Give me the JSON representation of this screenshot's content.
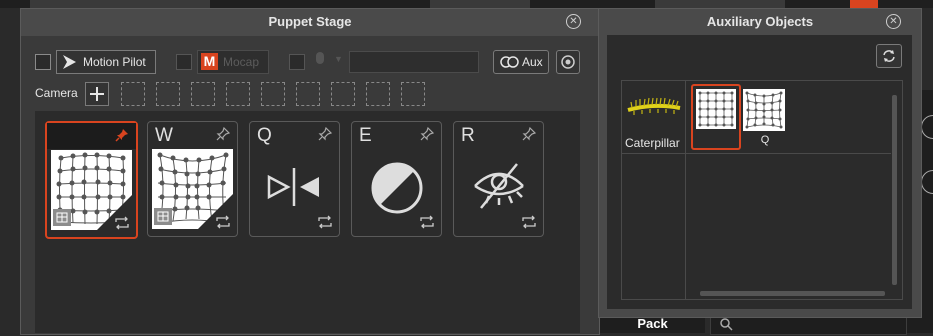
{
  "puppet_stage": {
    "title": "Puppet Stage",
    "motion_pilot_label": "Motion Pilot",
    "mocap_label": "Mocap",
    "aux_label": "Aux",
    "camera_label": "Camera",
    "cards": [
      {
        "key": "",
        "pinned": true,
        "selected": true,
        "icon": "mesh-grid-icon"
      },
      {
        "key": "W",
        "pinned": false,
        "selected": false,
        "icon": "warped-mesh-icon"
      },
      {
        "key": "Q",
        "pinned": false,
        "selected": false,
        "icon": "flip-icon"
      },
      {
        "key": "E",
        "pinned": false,
        "selected": false,
        "icon": "contrast-icon"
      },
      {
        "key": "R",
        "pinned": false,
        "selected": false,
        "icon": "eye-hidden-icon"
      }
    ]
  },
  "aux_objects": {
    "title": "Auxiliary Objects",
    "category_label": "Caterpillar",
    "items": [
      {
        "label": "",
        "selected": true,
        "icon": "mesh-grid-icon"
      },
      {
        "label": "Q",
        "selected": false,
        "icon": "warped-mesh-icon"
      }
    ]
  },
  "background": {
    "pack_label": "Pack"
  },
  "colors": {
    "accent": "#d9441f",
    "panel": "#4a4a4a",
    "inner": "#2b2b2b"
  }
}
